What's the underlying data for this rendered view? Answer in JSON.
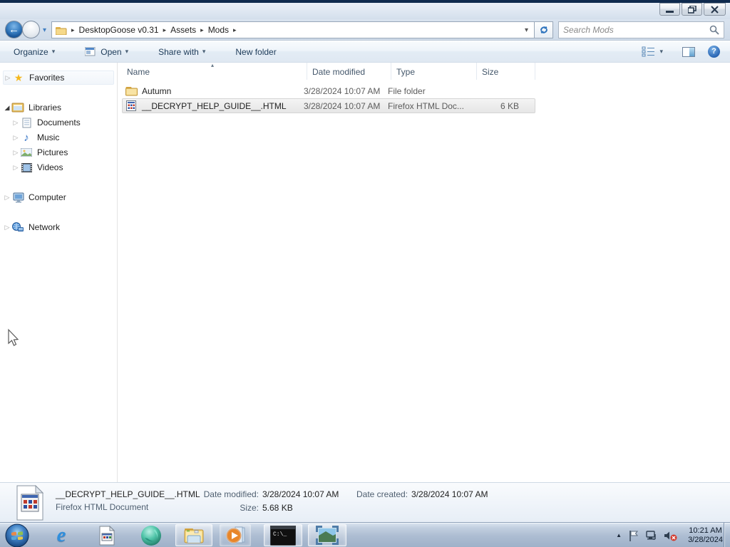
{
  "window": {
    "minimize": "minimize",
    "restore": "restore",
    "close": "close"
  },
  "address_bar": {
    "crumbs": [
      "DesktopGoose v0.31",
      "Assets",
      "Mods"
    ],
    "search_placeholder": "Search Mods"
  },
  "toolbar": {
    "organize": "Organize",
    "open": "Open",
    "share_with": "Share with",
    "new_folder": "New folder",
    "help_glyph": "?"
  },
  "sidebar": {
    "favorites": "Favorites",
    "libraries": "Libraries",
    "documents": "Documents",
    "music": "Music",
    "pictures": "Pictures",
    "videos": "Videos",
    "computer": "Computer",
    "network": "Network"
  },
  "file_list": {
    "columns": {
      "name": "Name",
      "date_modified": "Date modified",
      "type": "Type",
      "size": "Size"
    },
    "rows": [
      {
        "name": "Autumn",
        "date_modified": "3/28/2024 10:07 AM",
        "type": "File folder",
        "size": ""
      },
      {
        "name": "__DECRYPT_HELP_GUIDE__.HTML",
        "date_modified": "3/28/2024 10:07 AM",
        "type": "Firefox HTML Doc...",
        "size": "6 KB"
      }
    ]
  },
  "details_pane": {
    "file_name": "__DECRYPT_HELP_GUIDE__.HTML",
    "file_type": "Firefox HTML Document",
    "date_modified_label": "Date modified:",
    "date_modified_value": "3/28/2024 10:07 AM",
    "size_label": "Size:",
    "size_value": "5.68 KB",
    "date_created_label": "Date created:",
    "date_created_value": "3/28/2024 10:07 AM"
  },
  "taskbar": {
    "clock_time": "10:21 AM",
    "clock_date": "3/28/2024",
    "cmd_icon_text": "C:\\_",
    "ie_icon_glyph": "e"
  },
  "icons": {
    "music_note": "♪",
    "favorites_star": "★",
    "crumb_separator": "▸",
    "caret_down": "▾",
    "caret_up": "▴",
    "tree_collapsed": "▷",
    "tree_expanded": "◢",
    "tray_chevron": "▲"
  }
}
